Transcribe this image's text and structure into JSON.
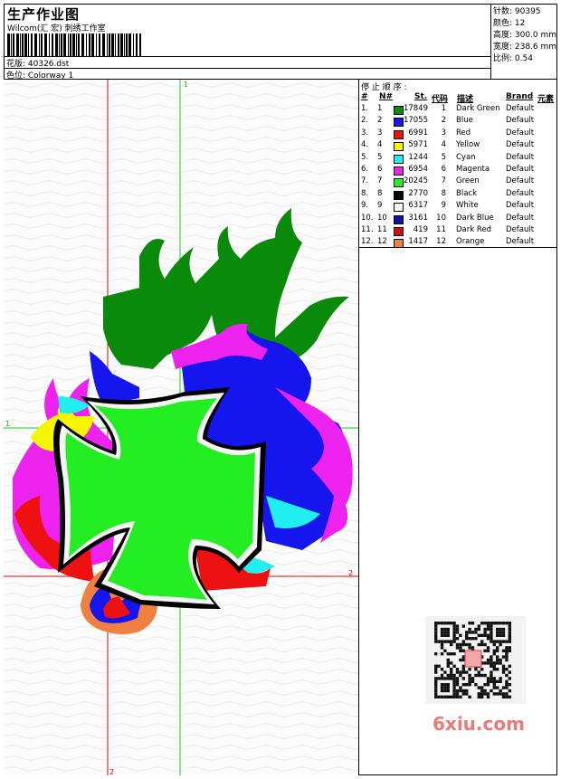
{
  "header": {
    "title": "生产作业图",
    "subtitle": "Wilcom(汇 宏) 刺绣工作室",
    "design_label": "花版: 40326.dst",
    "colorway_label": "色位: Colorway 1"
  },
  "stats": [
    "针数: 90395",
    "颜色: 12",
    "高度: 300.0 mm",
    "宽度: 238.6 mm",
    "比例: 0.54"
  ],
  "panel": {
    "title": "停 止 顺 序 :",
    "columns": {
      "hash": "#",
      "n": "N#",
      "st": "St.",
      "code": "代码",
      "desc": "描述",
      "brand": "Brand",
      "elem": "元素"
    },
    "rows": [
      {
        "hash": "1.",
        "n": "1",
        "st": "17849",
        "code": "1",
        "desc": "Dark Green",
        "brand": "Default",
        "color": "#0a8a0a"
      },
      {
        "hash": "2.",
        "n": "2",
        "st": "17055",
        "code": "2",
        "desc": "Blue",
        "brand": "Default",
        "color": "#1515ee"
      },
      {
        "hash": "3.",
        "n": "3",
        "st": "6991",
        "code": "3",
        "desc": "Red",
        "brand": "Default",
        "color": "#ee1111"
      },
      {
        "hash": "4.",
        "n": "4",
        "st": "5971",
        "code": "4",
        "desc": "Yellow",
        "brand": "Default",
        "color": "#f5f500"
      },
      {
        "hash": "5.",
        "n": "5",
        "st": "1244",
        "code": "5",
        "desc": "Cyan",
        "brand": "Default",
        "color": "#22eef0"
      },
      {
        "hash": "6.",
        "n": "6",
        "st": "6954",
        "code": "6",
        "desc": "Magenta",
        "brand": "Default",
        "color": "#ee22ee"
      },
      {
        "hash": "7.",
        "n": "7",
        "st": "20245",
        "code": "7",
        "desc": "Green",
        "brand": "Default",
        "color": "#22ee22"
      },
      {
        "hash": "8.",
        "n": "8",
        "st": "2770",
        "code": "8",
        "desc": "Black",
        "brand": "Default",
        "color": "#000000"
      },
      {
        "hash": "9.",
        "n": "9",
        "st": "6317",
        "code": "9",
        "desc": "White",
        "brand": "Default",
        "color": "#f5f5f5"
      },
      {
        "hash": "10.",
        "n": "10",
        "st": "3161",
        "code": "10",
        "desc": "Dark Blue",
        "brand": "Default",
        "color": "#1010b0"
      },
      {
        "hash": "11.",
        "n": "11",
        "st": "419",
        "code": "11",
        "desc": "Dark Red",
        "brand": "Default",
        "color": "#cc1010"
      },
      {
        "hash": "12.",
        "n": "12",
        "st": "1417",
        "code": "12",
        "desc": "Orange",
        "brand": "Default",
        "color": "#f08040"
      }
    ]
  },
  "guides": {
    "v1": "1",
    "h1": "1",
    "v2": "2",
    "h2": "2"
  },
  "watermark": "6xiu.com",
  "colors": {
    "guide_green": "#22cc22",
    "guide_red": "#cc1111"
  }
}
